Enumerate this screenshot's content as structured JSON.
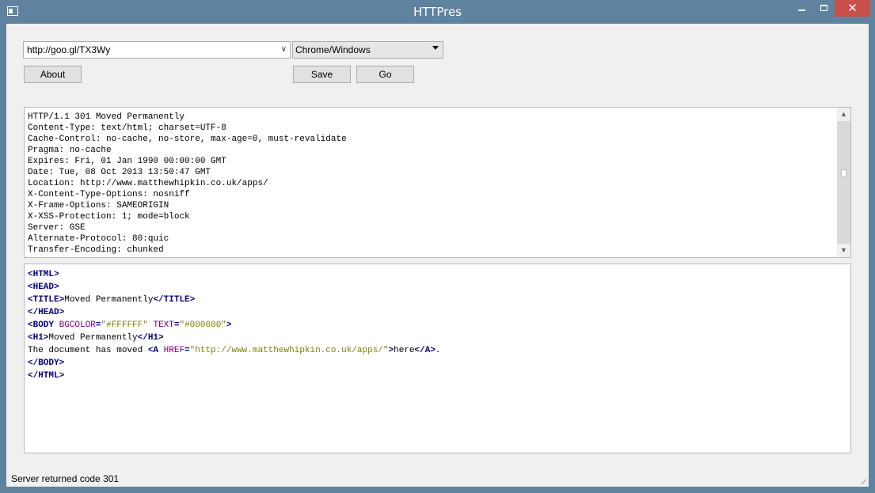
{
  "window": {
    "title": "HTTPres",
    "close_glyph": "✕"
  },
  "request": {
    "url": "http://goo.gl/TX3Wy",
    "user_agent": "Chrome/Windows",
    "about_label": "About",
    "save_label": "Save",
    "go_label": "Go"
  },
  "headers": [
    "HTTP/1.1 301 Moved Permanently",
    "Content-Type: text/html; charset=UTF-8",
    "Cache-Control: no-cache, no-store, max-age=0, must-revalidate",
    "Pragma: no-cache",
    "Expires: Fri, 01 Jan 1990 00:00:00 GMT",
    "Date: Tue, 08 Oct 2013 13:50:47 GMT",
    "Location: http://www.matthewhipkin.co.uk/apps/",
    "X-Content-Type-Options: nosniff",
    "X-Frame-Options: SAMEORIGIN",
    "X-XSS-Protection: 1; mode=block",
    "Server: GSE",
    "Alternate-Protocol: 80:quic",
    "Transfer-Encoding: chunked"
  ],
  "body_lines": [
    [
      {
        "t": "tag",
        "v": "<HTML>"
      }
    ],
    [
      {
        "t": "tag",
        "v": "<HEAD>"
      }
    ],
    [
      {
        "t": "tag",
        "v": "<TITLE>"
      },
      {
        "t": "txt",
        "v": "Moved Permanently"
      },
      {
        "t": "tag",
        "v": "</TITLE>"
      }
    ],
    [
      {
        "t": "tag",
        "v": "</HEAD>"
      }
    ],
    [
      {
        "t": "tag",
        "v": "<BODY "
      },
      {
        "t": "attr",
        "v": "BGCOLOR"
      },
      {
        "t": "tag",
        "v": "="
      },
      {
        "t": "str",
        "v": "\"#FFFFFF\""
      },
      {
        "t": "txt",
        "v": " "
      },
      {
        "t": "attr",
        "v": "TEXT"
      },
      {
        "t": "tag",
        "v": "="
      },
      {
        "t": "str",
        "v": "\"#000000\""
      },
      {
        "t": "tag",
        "v": ">"
      }
    ],
    [
      {
        "t": "tag",
        "v": "<H1>"
      },
      {
        "t": "txt",
        "v": "Moved Permanently"
      },
      {
        "t": "tag",
        "v": "</H1>"
      }
    ],
    [
      {
        "t": "txt",
        "v": "The document has moved "
      },
      {
        "t": "tag",
        "v": "<A "
      },
      {
        "t": "attr",
        "v": "HREF"
      },
      {
        "t": "tag",
        "v": "="
      },
      {
        "t": "str",
        "v": "\"http://www.matthewhipkin.co.uk/apps/\""
      },
      {
        "t": "tag",
        "v": ">"
      },
      {
        "t": "txt",
        "v": "here"
      },
      {
        "t": "tag",
        "v": "</A>"
      },
      {
        "t": "txt",
        "v": "."
      }
    ],
    [
      {
        "t": "tag",
        "v": "</BODY>"
      }
    ],
    [
      {
        "t": "tag",
        "v": "</HTML>"
      }
    ]
  ],
  "status": {
    "text": "Server returned code 301"
  }
}
